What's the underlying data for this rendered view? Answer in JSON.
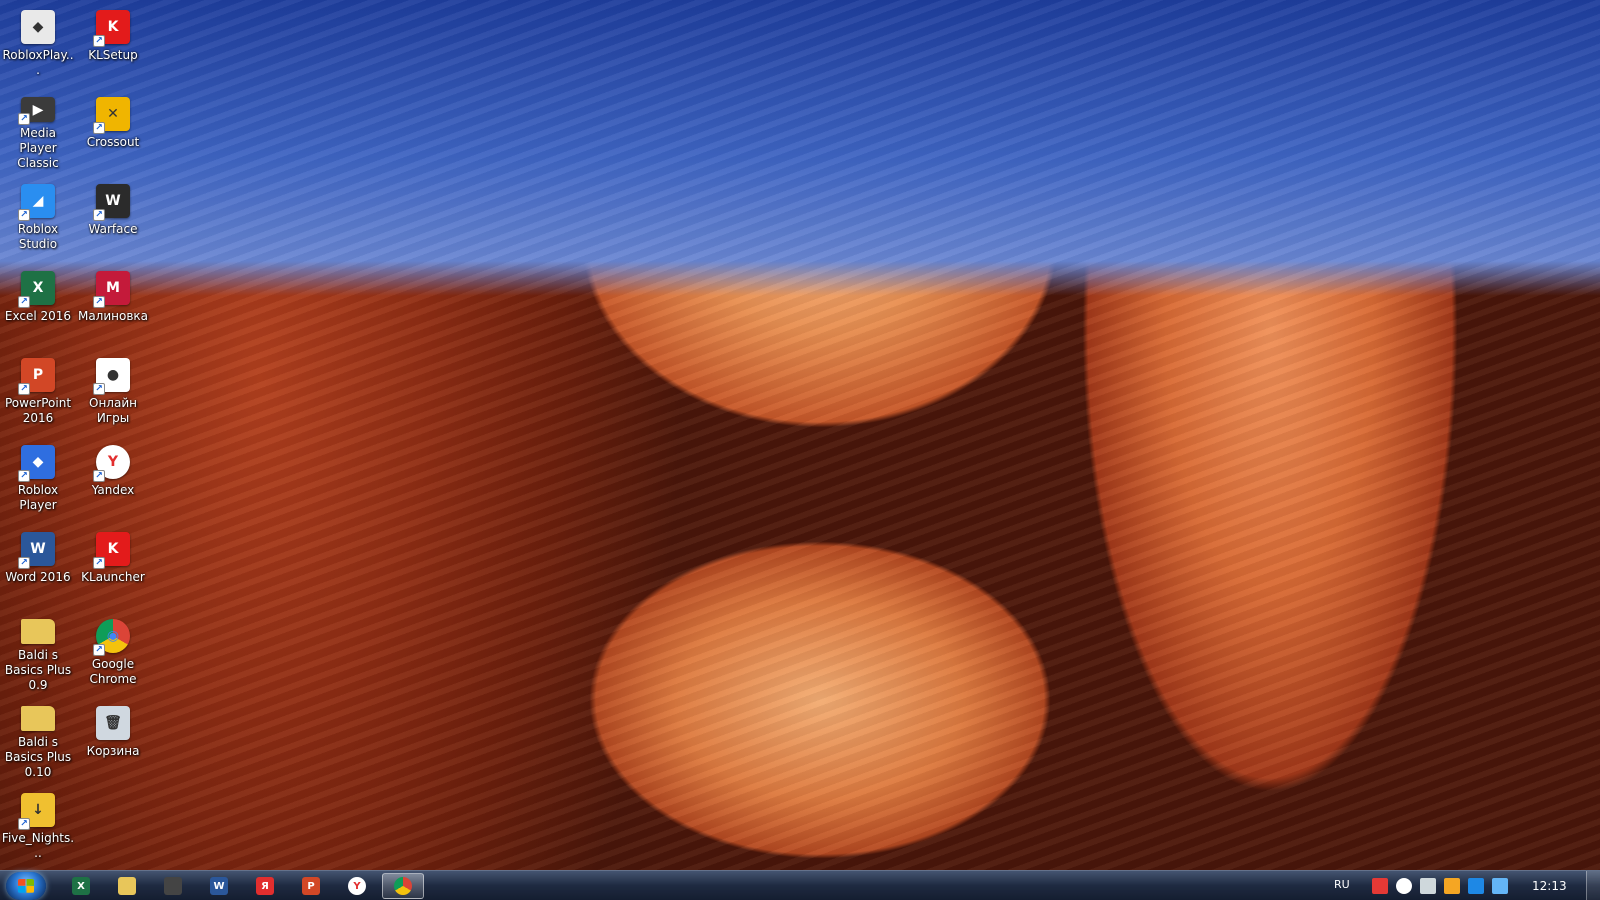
{
  "desktop": {
    "icons": [
      {
        "label": "RobloxPlay...",
        "icon": "roblox-player-icon",
        "color": "#e9e9e9"
      },
      {
        "label": "KLSetup",
        "icon": "klsetup-icon",
        "color": "#e31b1b"
      },
      {
        "label": "Media Player Classic",
        "icon": "media-player-classic-icon",
        "color": "#3b3b3b"
      },
      {
        "label": "Crossout",
        "icon": "crossout-icon",
        "color": "#f0b500"
      },
      {
        "label": "Roblox Studio",
        "icon": "roblox-studio-icon",
        "color": "#2a8ef0"
      },
      {
        "label": "Warface",
        "icon": "warface-icon",
        "color": "#2b2b2b"
      },
      {
        "label": "Excel 2016",
        "icon": "excel-icon",
        "color": "#1e7145"
      },
      {
        "label": "Малиновка",
        "icon": "malinovka-icon",
        "color": "#c41a3a"
      },
      {
        "label": "PowerPoint 2016",
        "icon": "powerpoint-icon",
        "color": "#d24726"
      },
      {
        "label": "Онлайн Игры",
        "icon": "online-games-icon",
        "color": "#ffffff"
      },
      {
        "label": "Roblox Player",
        "icon": "roblox-player-2-icon",
        "color": "#2f6ee0"
      },
      {
        "label": "Yandex",
        "icon": "yandex-browser-icon",
        "color": "#ffffff"
      },
      {
        "label": "Word 2016",
        "icon": "word-icon",
        "color": "#2b579a"
      },
      {
        "label": "KLauncher",
        "icon": "klauncher-icon",
        "color": "#e31b1b"
      },
      {
        "label": "Baldi s Basics Plus 0.9",
        "icon": "folder-icon",
        "color": "#e8c65a"
      },
      {
        "label": "Google Chrome",
        "icon": "chrome-icon",
        "color": "#ffffff"
      },
      {
        "label": "Baldi s Basics Plus 0.10",
        "icon": "folder-icon",
        "color": "#e8c65a"
      },
      {
        "label": "Корзина",
        "icon": "recycle-bin-icon",
        "color": "#d0d8e0"
      },
      {
        "label": "Five_Nights...",
        "icon": "download-folder-icon",
        "color": "#f0c030"
      }
    ]
  },
  "taskbar": {
    "start_icon": "windows-start-icon",
    "pinned": [
      {
        "icon": "excel-icon",
        "text": "X",
        "color": "#1e7145"
      },
      {
        "icon": "explorer-icon",
        "text": "",
        "color": "#e8c65a"
      },
      {
        "icon": "media-player-classic-icon",
        "text": "",
        "color": "#444444"
      },
      {
        "icon": "word-icon",
        "text": "W",
        "color": "#2b579a"
      },
      {
        "icon": "yandex-icon",
        "text": "Я",
        "color": "#e22e2e"
      },
      {
        "icon": "powerpoint-icon",
        "text": "P",
        "color": "#d24726"
      },
      {
        "icon": "yandex-browser-icon",
        "text": "Y",
        "color": "#ffffff"
      },
      {
        "icon": "chrome-icon",
        "text": "",
        "color": "#ffffff",
        "active": true
      }
    ],
    "tray": {
      "language": "RU",
      "icons": [
        "flag-alert-icon",
        "yandex-browser-icon",
        "volume-icon",
        "kaspersky-icon",
        "network-icon",
        "action-center-icon"
      ],
      "clock": "12:13"
    }
  }
}
